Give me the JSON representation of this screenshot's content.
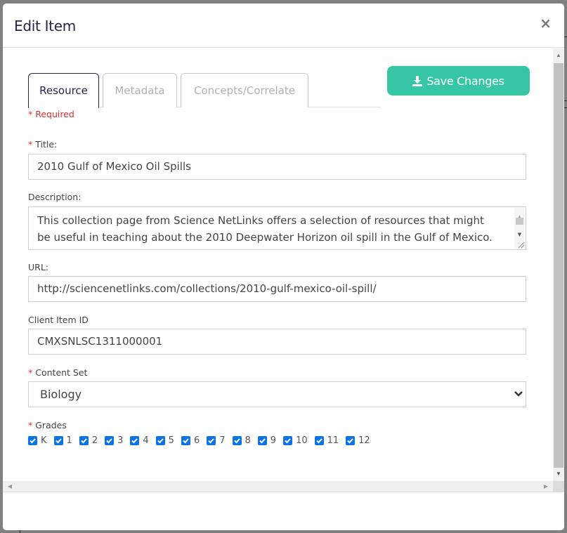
{
  "modal": {
    "title": "Edit Item",
    "close_icon": "×"
  },
  "tabs": [
    {
      "label": "Resource",
      "active": true
    },
    {
      "label": "Metadata",
      "active": false
    },
    {
      "label": "Concepts/Correlate",
      "active": false
    }
  ],
  "save_button": {
    "label": "Save Changes",
    "icon": "download-icon"
  },
  "required_note": "* Required",
  "fields": {
    "title": {
      "label": "Title:",
      "required": true,
      "value": "2010 Gulf of Mexico Oil Spills"
    },
    "description": {
      "label": "Description:",
      "required": false,
      "value": "This collection page from Science NetLinks offers a selection of resources that might be useful in teaching about the 2010 Deepwater Horizon oil spill in the Gulf of Mexico. Resources include lessons, tools, interactives, and related media."
    },
    "url": {
      "label": "URL:",
      "required": false,
      "value": "http://sciencenetlinks.com/collections/2010-gulf-mexico-oil-spill/"
    },
    "client_item_id": {
      "label": "Client Item ID",
      "required": false,
      "value": "CMXSNLSC1311000001"
    },
    "content_set": {
      "label": "Content Set",
      "required": true,
      "value": "Biology"
    },
    "grades": {
      "label": "Grades",
      "required": true,
      "options": [
        {
          "label": "K",
          "checked": true
        },
        {
          "label": "1",
          "checked": true
        },
        {
          "label": "2",
          "checked": true
        },
        {
          "label": "3",
          "checked": true
        },
        {
          "label": "4",
          "checked": true
        },
        {
          "label": "5",
          "checked": true
        },
        {
          "label": "6",
          "checked": true
        },
        {
          "label": "7",
          "checked": true
        },
        {
          "label": "8",
          "checked": true
        },
        {
          "label": "9",
          "checked": true
        },
        {
          "label": "10",
          "checked": true
        },
        {
          "label": "11",
          "checked": true
        },
        {
          "label": "12",
          "checked": true
        }
      ]
    }
  },
  "colors": {
    "accent": "#36c5a5",
    "required": "#e02a2a",
    "checkbox": "#0b73e6",
    "title": "#25264a"
  }
}
